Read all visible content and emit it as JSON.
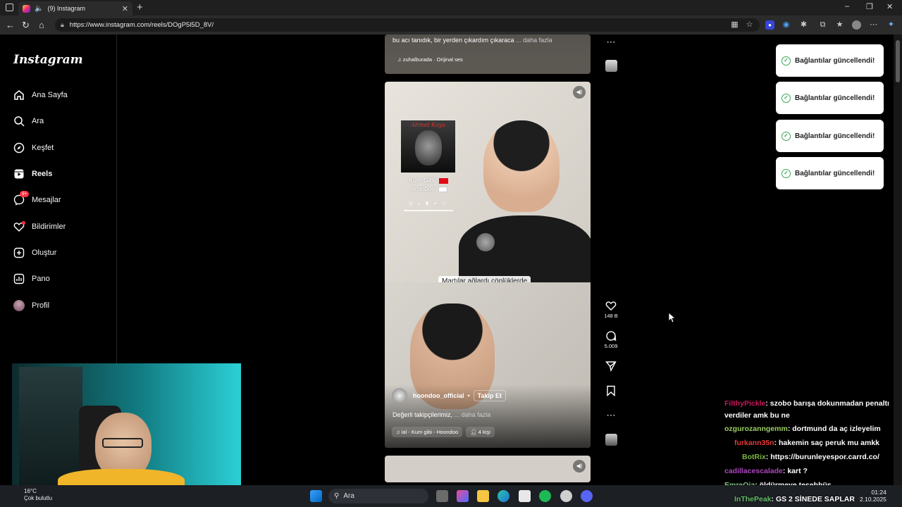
{
  "browser": {
    "tab_title": "(9) Instagram",
    "new_tab": "+",
    "url": "https://www.instagram.com/reels/DOgP5l5D_8V/",
    "window_controls": [
      "–",
      "❐",
      "✕"
    ]
  },
  "sidebar": {
    "logo": "Instagram",
    "items": [
      {
        "label": "Ana Sayfa",
        "icon": "home-icon"
      },
      {
        "label": "Ara",
        "icon": "search-icon"
      },
      {
        "label": "Keşfet",
        "icon": "compass-icon"
      },
      {
        "label": "Reels",
        "icon": "reels-icon"
      },
      {
        "label": "Mesajlar",
        "icon": "messenger-icon",
        "badge": "9+"
      },
      {
        "label": "Bildirimler",
        "icon": "heart-icon"
      },
      {
        "label": "Oluştur",
        "icon": "create-icon"
      },
      {
        "label": "Pano",
        "icon": "dashboard-icon"
      },
      {
        "label": "Profil",
        "icon": "avatar-icon"
      }
    ]
  },
  "reel_top": {
    "caption": "bu acı tanıdık, bir yerden çıkardım çıkaraca",
    "more": "... daha fazla",
    "audio": "zuhalburada · Orijinal ses"
  },
  "reel_main": {
    "album_title": "Ahmet Kaya",
    "song_line1": "Kum Gibi",
    "song_line2": "HoonDoo",
    "subtitle": "Martılar ağlardı çöplüklerde",
    "username": "hoondoo_official",
    "follow": "Takip Et",
    "caption": "Değerli takipçilerimiz,",
    "more": "... daha fazla",
    "audio": "ial - Kum gibi - Hoondoo",
    "people": "4 kişi"
  },
  "actions": {
    "likes": "148 B",
    "comments": "5.009"
  },
  "toasts": [
    "Bağlantılar güncellendi!",
    "Bağlantılar güncellendi!",
    "Bağlantılar güncellendi!",
    "Bağlantılar güncellendi!"
  ],
  "chat": [
    {
      "user": "FilthyPickle",
      "color": "#c2185b",
      "msg": ": szobo barışa dokunmadan penaltı"
    },
    {
      "user": "",
      "color": "#ffffff",
      "msg": "verdiler amk bu ne"
    },
    {
      "user": "ozgurozanngemm",
      "color": "#9ccc65",
      "msg": ": dortmund da aç izleyelim"
    },
    {
      "user": "furkann35n",
      "color": "#e53935",
      "msg": ": hakemin saç peruk mu amkk"
    },
    {
      "user": "BotRix",
      "color": "#7cb342",
      "msg": ": https://burunleyespor.carrd.co/"
    },
    {
      "user": "cadillacescalade",
      "color": "#ab47bc",
      "msg": ": kart ?"
    },
    {
      "user": "EmreQia",
      "color": "#81c784",
      "msg": ": öldürmeye teşebbüs"
    },
    {
      "user": "InThePeak",
      "color": "#66bb6a",
      "msg": ": GS 2 SİNEDE SAPLAR"
    }
  ],
  "taskbar": {
    "weather_temp": "16°C",
    "weather_text": "Çok bulutlu",
    "search_placeholder": "Ara",
    "time": "01:24",
    "date": "2.10.2025"
  }
}
